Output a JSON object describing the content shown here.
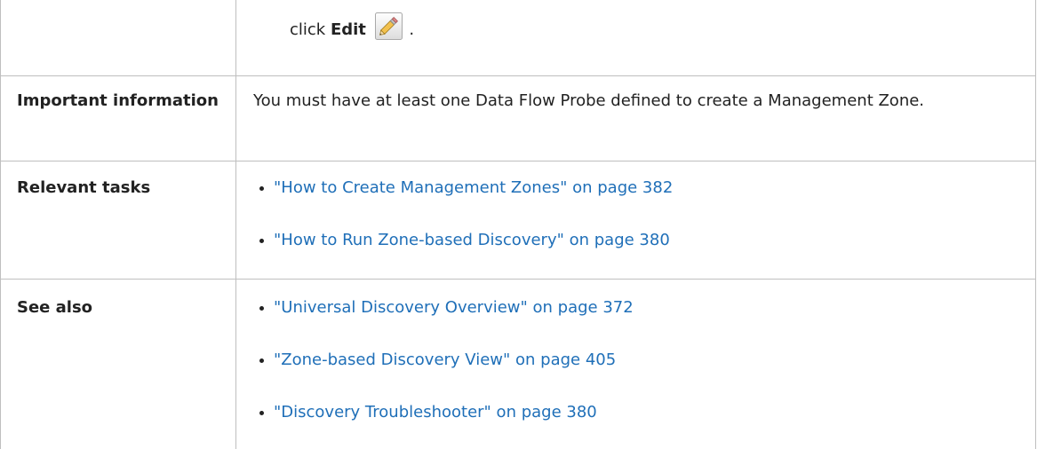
{
  "edit_row": {
    "prefix": "click",
    "action_label": "Edit",
    "icon": "pencil-edit-icon",
    "suffix": "."
  },
  "rows": [
    {
      "label": "Important information",
      "text": "You must have at least one Data Flow Probe defined to create a Management Zone."
    },
    {
      "label": "Relevant tasks",
      "links": [
        "\"How to Create Management Zones\" on page 382",
        "\"How to Run Zone-based Discovery\" on page 380"
      ]
    },
    {
      "label": "See also",
      "links": [
        "\"Universal Discovery Overview\" on page 372",
        "\"Zone-based Discovery View\" on page 405",
        "\"Discovery Troubleshooter\" on page 380"
      ]
    }
  ],
  "colors": {
    "link": "#1f6fb8",
    "border": "#bfbfbf",
    "text": "#222222"
  }
}
